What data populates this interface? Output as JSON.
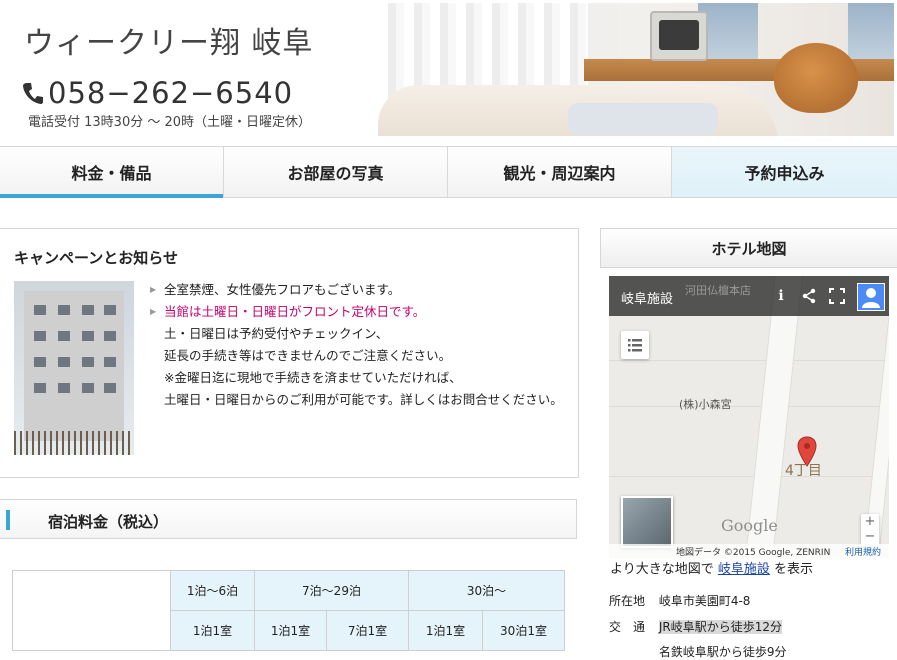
{
  "header": {
    "site_title": "ウィークリー翔 岐阜",
    "phone_number": "058−262−6540",
    "phone_hours": "電話受付 13時30分 ～ 20時（土曜・日曜定休）"
  },
  "nav": {
    "items": [
      {
        "label": "料金・備品"
      },
      {
        "label": "お部屋の写真"
      },
      {
        "label": "観光・周辺案内"
      },
      {
        "label": "予約申込み"
      }
    ]
  },
  "campaign": {
    "title": "キャンペーンとお知らせ",
    "lines": [
      "全室禁煙、女性優先フロアもございます。",
      "当館は土曜日・日曜日がフロント定休日です。",
      "土・日曜日は予約受付やチェックイン、",
      "延長の手続き等はできませんのでご注意ください。",
      "※金曜日迄に現地で手続きを済ませていただければ、",
      "土曜日・日曜日からのご利用が可能です。詳しくはお問合せください。"
    ]
  },
  "rates": {
    "title": "宿泊料金（税込）",
    "header_row1": [
      "1泊～6泊",
      "7泊～29泊",
      "30泊～"
    ],
    "header_row2": [
      "1泊1室",
      "1泊1室",
      "7泊1室",
      "1泊1室",
      "30泊1室"
    ]
  },
  "map": {
    "panel_title": "ホテル地図",
    "embed_title": "岐阜施設",
    "bg_label_top": "河田仏檀本店",
    "label_company": "(株)小森宮",
    "pin_label": "4丁目",
    "google": "Google",
    "credit": "地図データ ©2015 Google, ZENRIN",
    "terms": "利用規約",
    "link_prefix": "より大きな地図で",
    "link_text": "岐阜施設",
    "link_suffix": "を表示"
  },
  "info": {
    "address_label": "所在地",
    "address": "岐阜市美園町4-8",
    "transit_label": "交　通",
    "transit1": "JR岐阜駅から徒歩12分",
    "transit2": "名鉄岐阜駅から徒歩9分"
  },
  "colors": {
    "accent": "#3aa6d6",
    "notice_red": "#c6006b",
    "nav_reserve_bg": "#e9f6fb"
  }
}
